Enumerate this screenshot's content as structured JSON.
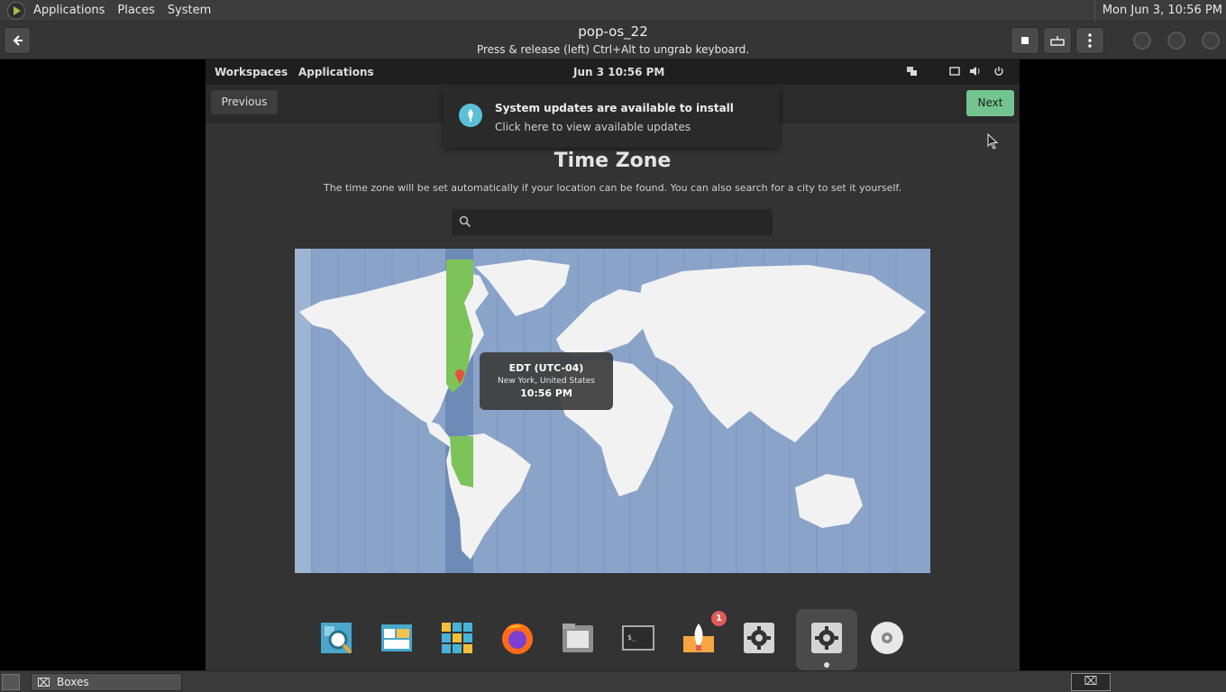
{
  "host_panel": {
    "menu": [
      "Applications",
      "Places",
      "System"
    ],
    "clock": "Mon Jun  3, 10:56 PM"
  },
  "boxes_header": {
    "title": "pop-os_22",
    "subtitle": "Press & release (left) Ctrl+Alt to ungrab keyboard."
  },
  "vm_panel": {
    "workspaces": "Workspaces",
    "applications": "Applications",
    "datetime": "Jun 3   10:56 PM"
  },
  "installer": {
    "previous_label": "Previous",
    "next_label": "Next",
    "title": "Time Zone",
    "description": "The time zone will be set automatically if your location can be found. You can also search for a city to set it yourself.",
    "search_value": "",
    "search_placeholder": ""
  },
  "notification": {
    "title": "System updates are available to install",
    "body": "Click here to view available updates"
  },
  "map_tooltip": {
    "zone": "EDT (UTC-04)",
    "location": "New York, United States",
    "time": "10:56 PM"
  },
  "dock": {
    "items": [
      "search-app-icon",
      "files-layout-icon",
      "app-grid-icon",
      "firefox-icon",
      "files-icon",
      "terminal-icon",
      "pop-shop-icon",
      "settings-icon",
      "installer-settings-icon",
      "disc-icon"
    ],
    "pop_shop_badge": "1"
  },
  "taskbar": {
    "task_label": "Boxes"
  },
  "colors": {
    "accent_green": "#73c48f",
    "map_ocean": "#8aa3c9",
    "selected_zone": "#7cc35a"
  }
}
